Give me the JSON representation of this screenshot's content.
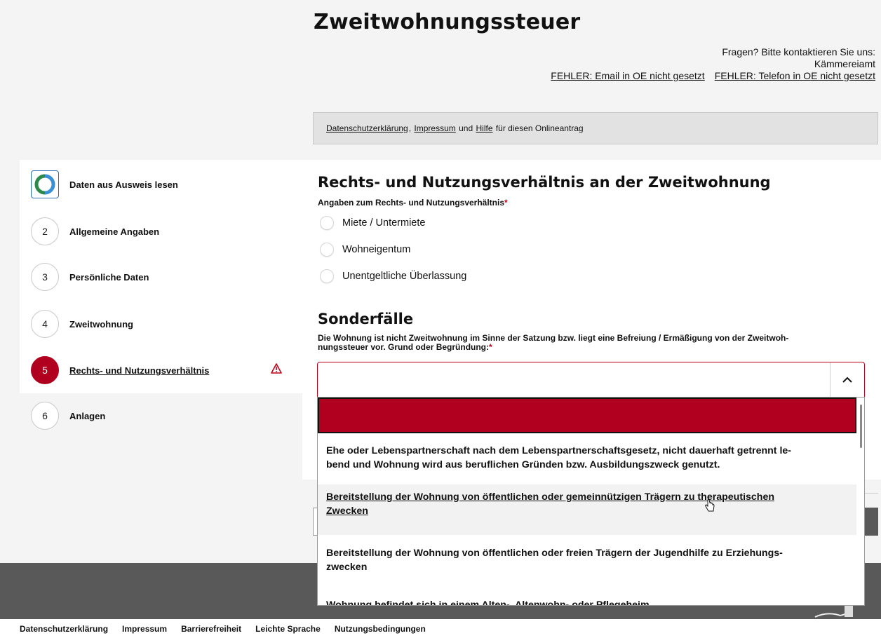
{
  "header": {
    "title": "Zweitwohnungssteuer",
    "contact_line1": "Fragen? Bitte kontaktieren Sie uns:",
    "contact_line2": "Kämmereiamt",
    "email_link": "FEHLER: Email in OE nicht gesetzt",
    "phone_link": "FEHLER: Telefon in OE nicht gesetzt"
  },
  "infobar": {
    "privacy": "Datenschutzerklärung",
    "sep1": ",",
    "imprint": "Impressum",
    "and": "und",
    "help": "Hilfe",
    "suffix": "für diesen Onlineantrag"
  },
  "sidebar": {
    "items": [
      {
        "number": "",
        "label": "Daten aus Ausweis lesen"
      },
      {
        "number": "2",
        "label": "Allgemeine Angaben"
      },
      {
        "number": "3",
        "label": "Persönliche Daten"
      },
      {
        "number": "4",
        "label": "Zweitwohnung"
      },
      {
        "number": "5",
        "label": "Rechts- und Nutzungsverhältnis"
      },
      {
        "number": "6",
        "label": "Anlagen"
      }
    ],
    "active_color": "#b1001f"
  },
  "section1": {
    "heading": "Rechts- und Nutzungsverhältnis an der Zweitwohnung",
    "question": "Angaben zum Rechts- und Nutzungsverhältnis",
    "required_mark": "*",
    "options": [
      "Miete / Untermiete",
      "Wohneigentum",
      "Unentgeltliche Überlassung"
    ]
  },
  "section2": {
    "heading": "Sonderfälle",
    "question_line1": "Die Wohnung ist nicht Zweitwohnung im Sinne der Satzung bzw. liegt eine Befreiung / Ermäßigung von der Zweitwoh-",
    "question_line2": "nungssteuer vor. Grund oder Begründung:",
    "required_mark": "*",
    "select_value": "",
    "dropdown_options": [
      {
        "line1": "Ehe oder Lebenspartnerschaft nach dem Lebenspartnerschaftsgesetz, nicht dauerhaft getrennt le-",
        "line2": "bend und Wohnung wird aus beruflichen Gründen bzw. Ausbildungszweck genutzt."
      },
      {
        "line1": "Bereitstellung der Wohnung von öffentlichen oder gemeinnützigen Trägern zu therapeutischen",
        "line2": "Zwecken"
      },
      {
        "line1": "Bereitstellung der Wohnung von öffentlichen oder freien Trägern der Jugendhilfe zu Erziehungs-",
        "line2": "zwecken"
      },
      {
        "line1": "Wohnung befindet sich in einem Alten-, Altenwohn- oder Pflegeheim",
        "line2": ""
      }
    ]
  },
  "footer": {
    "links": [
      "Datenschutzerklärung",
      "Impressum",
      "Barrierefreiheit",
      "Leichte Sprache",
      "Nutzungsbedingungen"
    ]
  }
}
